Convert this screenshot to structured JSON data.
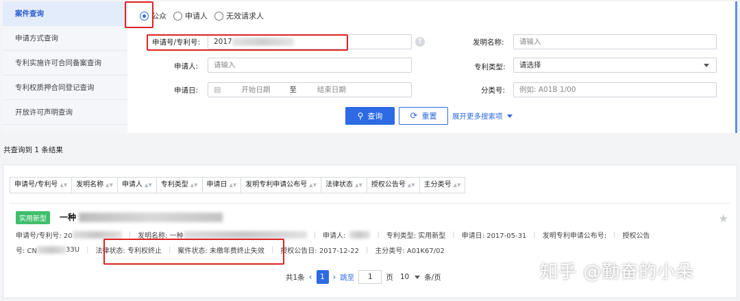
{
  "sidebar": {
    "items": [
      {
        "label": "案件查询"
      },
      {
        "label": "申请方式查询"
      },
      {
        "label": "专利实施许可合同备案查询"
      },
      {
        "label": "专利权质押合同登记查询"
      },
      {
        "label": "开放许可声明查询"
      }
    ]
  },
  "radios": [
    {
      "label": "公众"
    },
    {
      "label": "申请人"
    },
    {
      "label": "无效请求人"
    }
  ],
  "form": {
    "app_no_label": "申请号/专利号:",
    "app_no_value": "2017",
    "applicant_label": "申请人:",
    "applicant_placeholder": "请输入",
    "app_date_label": "申请日:",
    "start_date_placeholder": "开始日期",
    "date_to": "至",
    "end_date_placeholder": "结束日期",
    "invention_name_label": "发明名称:",
    "invention_name_placeholder": "请输入",
    "patent_type_label": "专利类型:",
    "patent_type_placeholder": "请选择",
    "class_no_label": "分类号:",
    "class_no_placeholder": "例如: A01B 1/00",
    "help_icon_text": "?"
  },
  "actions": {
    "search_label": "查询",
    "reset_label": "重置",
    "expand_label": "展开更多搜索项"
  },
  "results": {
    "count_text": "共查询到 1 条结果",
    "sort_fields": [
      "申请号/专利号",
      "发明名称",
      "申请人",
      "专利类型",
      "申请日",
      "发明专利申请公布号",
      "法律状态",
      "授权公告号",
      "主分类号"
    ],
    "item": {
      "tag": "实用新型",
      "title_prefix": "一种",
      "line1": {
        "app_no": "申请号/专利号: 20",
        "invention_name": "发明名称: 一种",
        "applicant": "申请人:",
        "patent_type": "专利类型: 实用新型",
        "app_date": "申请日: 2017-05-31",
        "publication_no": "发明专利申请公布号:",
        "grant_no_part1": "授权公告"
      },
      "line2": {
        "grant_no_part2": "号: CN",
        "grant_no_tail": "33U",
        "legal_status": "法律状态: 专利权终止",
        "case_status": "案件状态: 未缴年费终止失效",
        "grant_date": "授权公告日: 2017-12-22",
        "main_class": "主分类号: A01K67/02"
      }
    }
  },
  "pagination": {
    "total": "共1条",
    "current": "1",
    "jump_label": "跳至",
    "page_input": "1",
    "page_suffix": "页",
    "page_size": "10",
    "page_size_suffix": "条/页"
  },
  "watermark": "知乎 @勤奋的小朵",
  "colors": {
    "primary": "#2d6ae3",
    "highlight": "#e02020",
    "tag_green": "#3fbf6b"
  }
}
